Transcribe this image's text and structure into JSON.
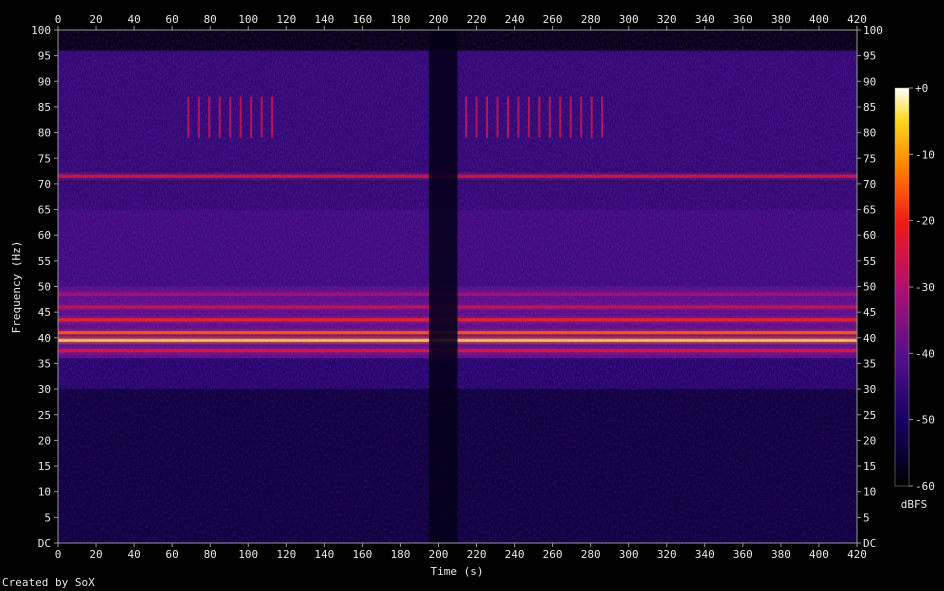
{
  "chart_data": {
    "type": "heatmap",
    "title": "",
    "xlabel": "Time (s)",
    "ylabel": "Frequency (Hz)",
    "xlim": [
      0,
      420
    ],
    "ylim": [
      0,
      100
    ],
    "x_ticks": [
      "0",
      "20",
      "40",
      "60",
      "80",
      "100",
      "120",
      "140",
      "160",
      "180",
      "200",
      "220",
      "240",
      "260",
      "280",
      "300",
      "320",
      "340",
      "360",
      "380",
      "400",
      "420"
    ],
    "y_ticks": [
      "DC",
      "5",
      "10",
      "15",
      "20",
      "25",
      "30",
      "35",
      "40",
      "45",
      "50",
      "55",
      "60",
      "65",
      "70",
      "75",
      "80",
      "85",
      "90",
      "95",
      "100"
    ],
    "colorbar": {
      "label": "dBFS",
      "range": [
        -60,
        0
      ],
      "ticks": [
        "+0",
        "-10",
        "-20",
        "-30",
        "-40",
        "-50",
        "-60"
      ]
    },
    "bands": [
      {
        "freq_hz": 39.5,
        "level_dbfs": -3
      },
      {
        "freq_hz": 41,
        "level_dbfs": -12
      },
      {
        "freq_hz": 43.5,
        "level_dbfs": -18
      },
      {
        "freq_hz": 37.5,
        "level_dbfs": -20
      },
      {
        "freq_hz": 71.5,
        "level_dbfs": -22
      },
      {
        "freq_hz": 46,
        "level_dbfs": -24
      },
      {
        "freq_hz": 48.5,
        "level_dbfs": -28
      }
    ],
    "quiet_interval_s": [
      195,
      210
    ],
    "burst_regions": [
      {
        "t_start_s": 68,
        "t_end_s": 112,
        "f_low_hz": 79,
        "f_high_hz": 87
      },
      {
        "t_start_s": 214,
        "t_end_s": 288,
        "f_low_hz": 79,
        "f_high_hz": 87
      }
    ],
    "noise_floor_dbfs": -52,
    "signal_top_hz": 96
  },
  "footer": {
    "credit": "Created by SoX"
  }
}
